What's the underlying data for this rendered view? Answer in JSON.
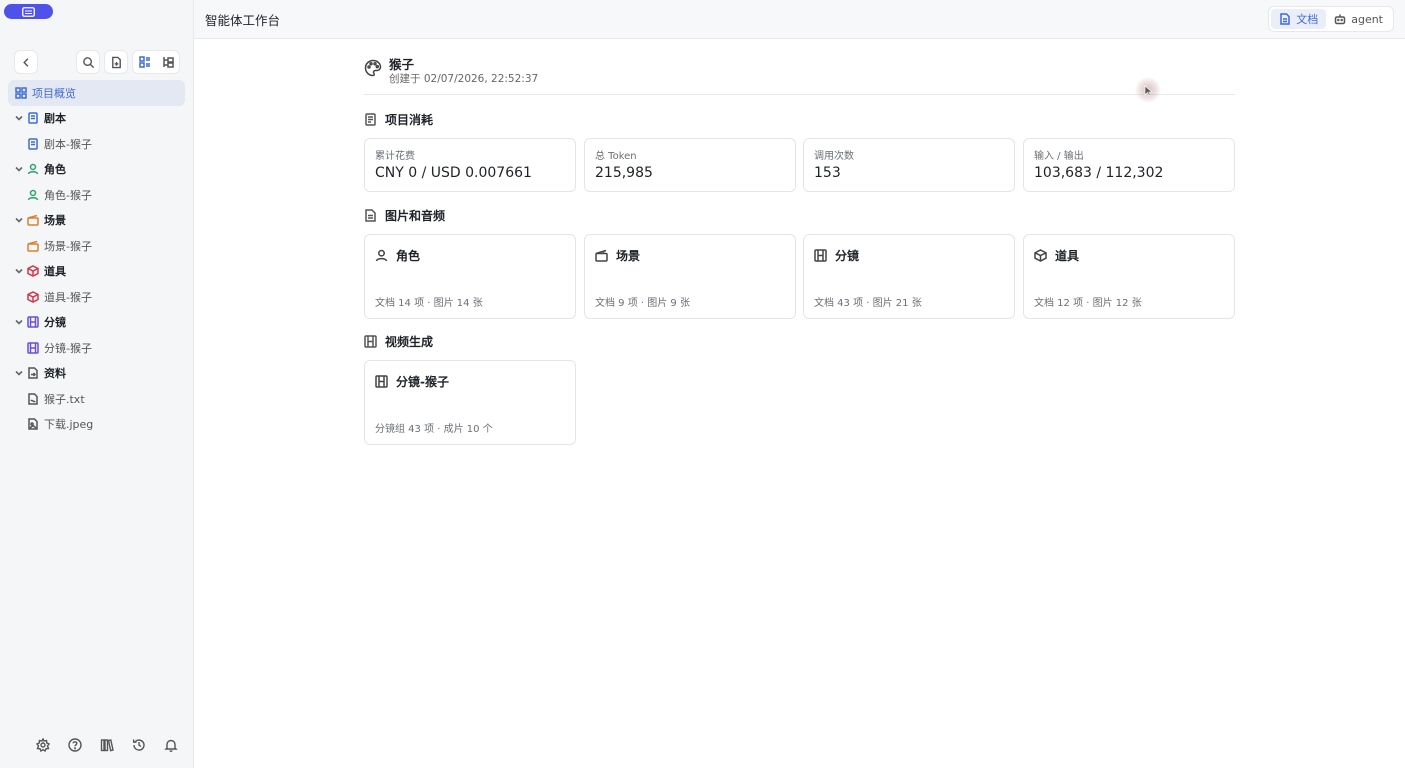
{
  "header": {
    "title": "智能体工作台",
    "tabs": [
      {
        "label": "文档",
        "icon": "document-icon",
        "active": true
      },
      {
        "label": "agent",
        "icon": "robot-icon",
        "active": false
      }
    ]
  },
  "sidebar": {
    "overview_label": "项目概览",
    "groups": [
      {
        "label": "剧本",
        "color": "#3e6ad8",
        "child": "剧本-猴子"
      },
      {
        "label": "角色",
        "color": "#2fa36b",
        "child": "角色-猴子"
      },
      {
        "label": "场景",
        "color": "#d9822b",
        "child": "场景-猴子"
      },
      {
        "label": "道具",
        "color": "#d8344b",
        "child": "道具-猴子"
      },
      {
        "label": "分镜",
        "color": "#6a4fd8",
        "child": "分镜-猴子"
      },
      {
        "label": "资料",
        "color": "#555555",
        "children": [
          "猴子.txt",
          "下载.jpeg"
        ]
      }
    ]
  },
  "project": {
    "name": "猴子",
    "created": "创建于 02/07/2026, 22:52:37"
  },
  "consumption": {
    "title": "项目消耗",
    "stats": [
      {
        "label": "累计花费",
        "value": "CNY 0 / USD 0.007661"
      },
      {
        "label": "总 Token",
        "value": "215,985"
      },
      {
        "label": "调用次数",
        "value": "153"
      },
      {
        "label": "输入 / 输出",
        "value": "103,683 / 112,302"
      }
    ]
  },
  "media": {
    "title": "图片和音频",
    "cards": [
      {
        "title": "角色",
        "sub": "文档 14 项 · 图片 14 张"
      },
      {
        "title": "场景",
        "sub": "文档 9 项 · 图片 9 张"
      },
      {
        "title": "分镜",
        "sub": "文档 43 项 · 图片 21 张"
      },
      {
        "title": "道具",
        "sub": "文档 12 项 · 图片 12 张"
      }
    ]
  },
  "video": {
    "title": "视频生成",
    "cards": [
      {
        "title": "分镜-猴子",
        "sub": "分镜组 43 项 · 成片 10 个"
      }
    ]
  }
}
